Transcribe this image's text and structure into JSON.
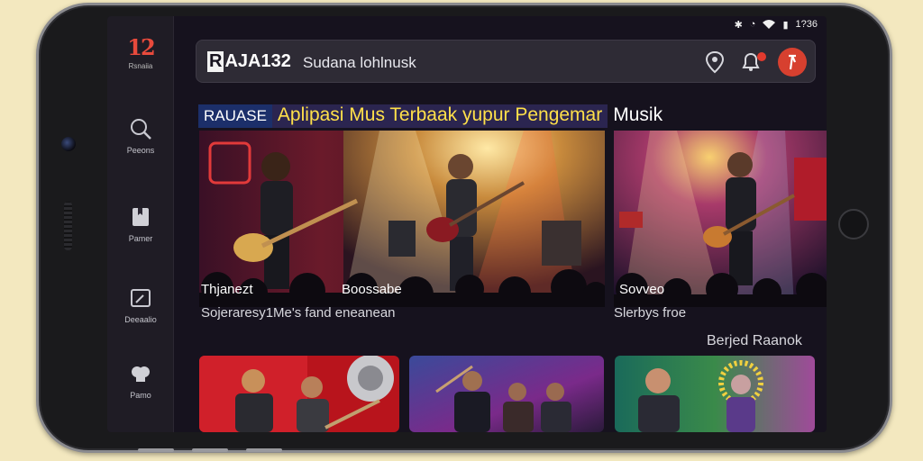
{
  "status_bar": {
    "icons": [
      "bluetooth-icon",
      "alarm-icon",
      "wifi-icon",
      "battery-icon"
    ],
    "time": "1?36"
  },
  "sidebar": {
    "logo_mark": "12",
    "logo_sub": "Rsnaiia",
    "items": [
      {
        "label": "Peeons",
        "icon": "search-icon"
      },
      {
        "label": "Pamer",
        "icon": "bookmark-icon"
      },
      {
        "label": "Deeaalio",
        "icon": "edit-icon"
      },
      {
        "label": "Pamo",
        "icon": "media-icon"
      }
    ]
  },
  "topbar": {
    "brand": "AJA132",
    "brand_initial": "R",
    "search_text": "Sudana lohlnusk",
    "icons": [
      "location-pin-icon",
      "notification-icon",
      "profile-avatar-icon"
    ]
  },
  "headline": {
    "tag": "RAUASE",
    "main": "Aplipasi Mus Terbaak yupur Pengemar",
    "end": "Musik"
  },
  "featured": [
    {
      "title": "Thjanezt",
      "description": "Sojeraresy1Me's fand eneanean"
    },
    {
      "title": "Boossabe"
    },
    {
      "title": "Sovveo",
      "description": "Slerbys froe"
    }
  ],
  "section": {
    "label": "Berjed Raanok"
  },
  "colors": {
    "accent": "#e84a3c",
    "background": "#16121e",
    "sidebar": "#1f1c25",
    "headline_yellow": "#ffe04a"
  }
}
